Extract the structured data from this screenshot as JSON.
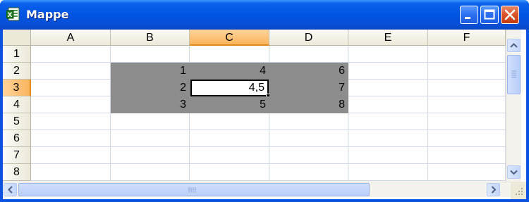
{
  "window": {
    "title": "Mappe",
    "icon": "excel-workbook-icon"
  },
  "columns": [
    "A",
    "B",
    "C",
    "D",
    "E",
    "F"
  ],
  "active_column": "C",
  "rows": [
    "1",
    "2",
    "3",
    "4",
    "5",
    "6",
    "7",
    "8"
  ],
  "active_row": "3",
  "cells": {
    "B2": "1",
    "C2": "4",
    "D2": "6",
    "B3": "2",
    "C3": "4,5",
    "D3": "7",
    "B4": "3",
    "C4": "5",
    "D4": "8"
  },
  "selection": "B2:D4",
  "active_cell": "C3",
  "colors": {
    "selection_fill": "#8c8c8c",
    "active_header": "#f9b55d",
    "title_bar": "#0054e3"
  }
}
